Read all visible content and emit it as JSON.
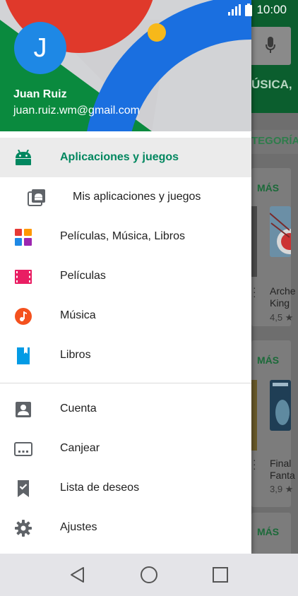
{
  "status_bar": {
    "time": "10:00"
  },
  "account": {
    "initial": "J",
    "name": "Juan Ruiz",
    "email": "juan.ruiz.wm@gmail.com"
  },
  "menu": {
    "apps": "Aplicaciones y juegos",
    "my_apps": "Mis aplicaciones y juegos",
    "movies_music_books": "Películas, Música, Libros",
    "movies": "Películas",
    "music": "Música",
    "books": "Libros",
    "account": "Cuenta",
    "redeem": "Canjear",
    "wishlist": "Lista de deseos",
    "settings": "Ajustes"
  },
  "background": {
    "tab_partial": "ÚSICA,",
    "category_partial": "TEGORÍA",
    "more_1": "MÁS",
    "more_2": "MÁS",
    "more_3": "MÁS",
    "app1_title_line1": "Arche",
    "app1_title_line2": "King",
    "app1_rating": "4,5 ★",
    "app2_title_line1": "Final",
    "app2_title_line2": "Fanta",
    "app2_rating": "3,9 ★"
  },
  "colors": {
    "accent_green": "#01875f",
    "avatar_blue": "#1e88e5",
    "movies_red": "#e91e63",
    "music_orange": "#f4511e",
    "books_blue": "#039be5"
  }
}
